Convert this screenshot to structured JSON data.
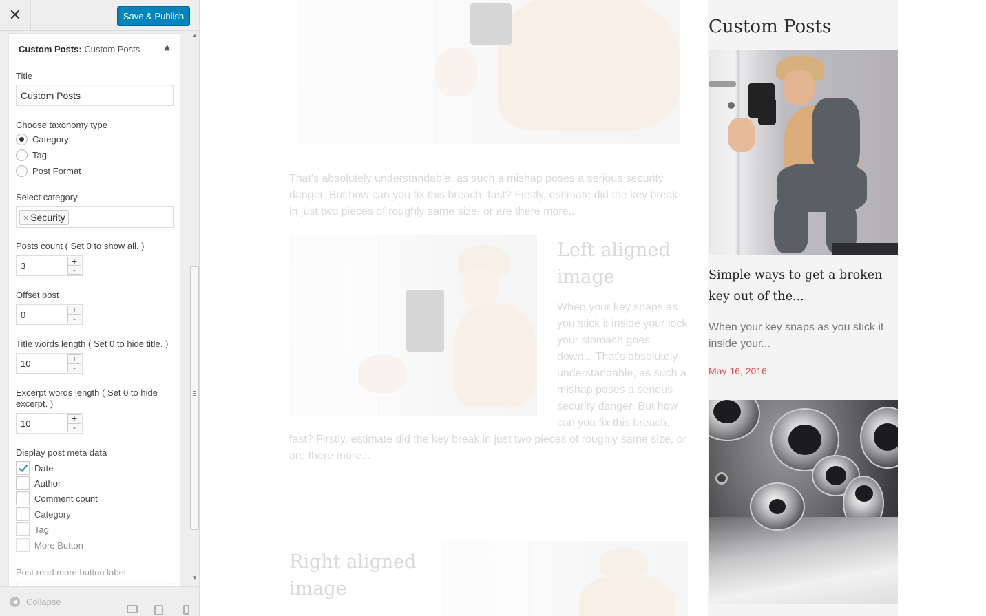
{
  "customizer": {
    "close_icon": "close-icon",
    "publish_label": "Save & Publish"
  },
  "widget": {
    "type_label": "Custom Posts:",
    "name": "Custom Posts",
    "title_label": "Title",
    "title_value": "Custom Posts",
    "taxonomy_label": "Choose taxonomy type",
    "taxonomy_options": [
      "Category",
      "Tag",
      "Post Format"
    ],
    "taxonomy_selected": "Category",
    "category_label": "Select category",
    "category_selected": "Security",
    "posts_count_label": "Posts count ( Set 0 to show all. )",
    "posts_count": "3",
    "offset_label": "Offset post",
    "offset": "0",
    "title_words_label": "Title words length ( Set 0 to hide title. )",
    "title_words": "10",
    "excerpt_words_label": "Excerpt words length ( Set 0 to hide excerpt. )",
    "excerpt_words": "10",
    "meta_label": "Display post meta data",
    "meta_options": [
      {
        "label": "Date",
        "checked": true
      },
      {
        "label": "Author",
        "checked": false
      },
      {
        "label": "Comment count",
        "checked": false
      },
      {
        "label": "Category",
        "checked": false
      },
      {
        "label": "Tag",
        "checked": false
      },
      {
        "label": "More Button",
        "checked": false
      }
    ],
    "read_more_label": "Post read more button label"
  },
  "footer": {
    "collapse_label": "Collapse"
  },
  "preview": {
    "article_paragraph": "That's absolutely understandable, as such a mishap poses a serious security danger. But how can you fix this breach, fast? Firstly, estimate did the key break in just two pieces of roughly same size, or are there more...",
    "left_title": "Left aligned image",
    "left_text": "When your key snaps as you stick it inside your lock your stomach goes down... That's absolutely understandable, as such a mishap poses a serious security danger. But how can you fix this breach, fast? Firstly, estimate did the key break in just two pieces of roughly same size, or are there more...",
    "right_title": "Right aligned image",
    "widget_title": "Custom Posts",
    "post_title": "Simple ways to get a broken key out of the...",
    "post_excerpt": "When your key snaps as you stick it inside your...",
    "post_date": "May 16, 2016",
    "accent_color": "#e05252",
    "publish_color": "#0085ba"
  }
}
